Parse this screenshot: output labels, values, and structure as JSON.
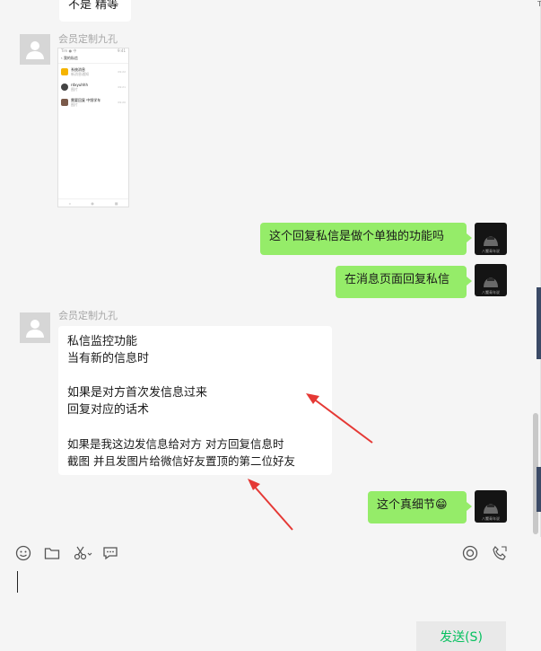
{
  "top_partial_message": "不是 精等",
  "edge_label": "TS",
  "messages": [
    {
      "side": "left",
      "nickname": "会员定制九孔",
      "type": "image",
      "screenshot": {
        "status_left": "Tim ● 中",
        "status_right": "9:41",
        "title": "我的私信",
        "rows": [
          {
            "name": "系统消息",
            "preview": "新消息通知",
            "time": "09:22"
          },
          {
            "name": "rdxyuhhh",
            "preview": "图片",
            "time": "09:21"
          },
          {
            "name": "需要回复 中频学车",
            "preview": "图片",
            "time": "09:20"
          }
        ]
      }
    },
    {
      "side": "right",
      "text": "这个回复私信是做个单独的功能吗"
    },
    {
      "side": "right",
      "text": "在消息页面回复私信"
    },
    {
      "side": "left",
      "nickname": "会员定制九孔",
      "type": "text",
      "lines": [
        "私信监控功能",
        "当有新的信息时",
        "",
        "如果是对方首次发信息过来",
        "回复对应的话术",
        "",
        "如果是我这边发信息给对方 对方回复信息时",
        "截图 并且发图片给微信好友置顶的第二位好友"
      ]
    },
    {
      "side": "right",
      "text": "这个真细节",
      "emoji": "😁"
    }
  ],
  "self_avatar_text": "八蟹青年说",
  "toolbar": {
    "left": [
      "emoji-icon",
      "folder-icon",
      "scissors-icon",
      "chat-icon"
    ],
    "right": [
      "video-call-icon",
      "phone-icon"
    ]
  },
  "input": {
    "value": ""
  },
  "send_label": "发送(S)",
  "colors": {
    "self_bubble": "#95ec69",
    "other_bubble": "#ffffff",
    "send_text": "#07c160",
    "annotation_arrow": "#e53935"
  }
}
